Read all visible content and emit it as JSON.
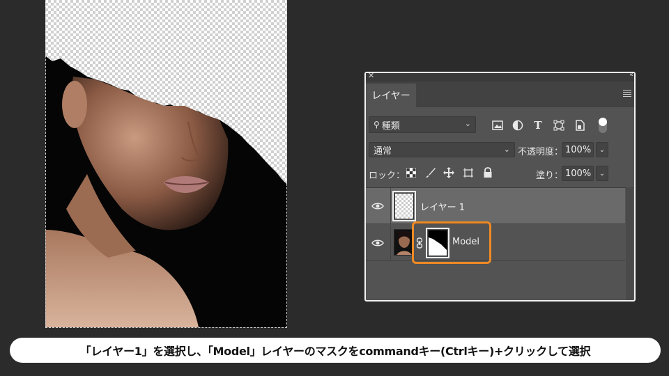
{
  "panel": {
    "tab_label": "レイヤー",
    "filter": {
      "value": "種類",
      "icons": [
        "image-filter-icon",
        "adjustment-filter-icon",
        "type-filter-icon",
        "shape-filter-icon",
        "smart-object-filter-icon"
      ],
      "type_glyph": "T"
    },
    "blend_mode": "通常",
    "opacity_label": "不透明度：",
    "opacity_value": "100%",
    "lock_label": "ロック：",
    "fill_label": "塗り：",
    "fill_value": "100%",
    "layers": [
      {
        "name": "レイヤー 1",
        "visible": true,
        "selected": true
      },
      {
        "name": "Model",
        "visible": true,
        "selected": false,
        "has_mask": true
      }
    ]
  },
  "caption": "「レイヤー1」を選択し、「Model」レイヤーのマスクをcommandキー(Ctrlキー)+クリックして選択",
  "colors": {
    "highlight": "#f08a24",
    "panel_bg": "#535353",
    "selected_row": "#6a6a6a"
  }
}
